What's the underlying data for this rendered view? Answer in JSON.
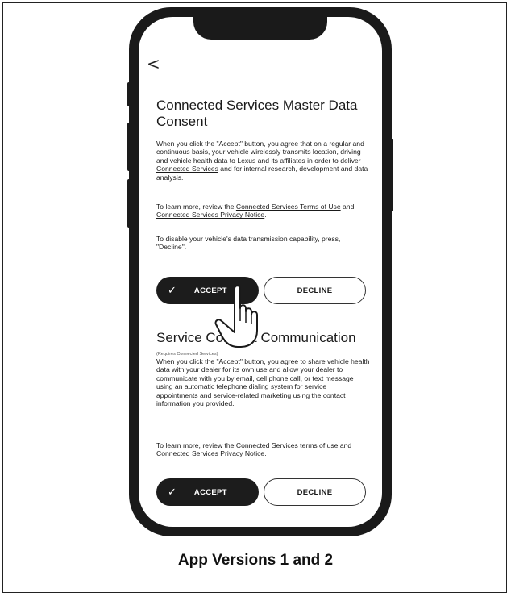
{
  "screen1": {
    "back_symbol": "<",
    "title": "Connected Services Master Data Consent",
    "para1_text": "When you click the \"Accept\" button, you agree that on a regular and continuous basis, your vehicle wirelessly transmits location, driving and vehicle health data to Lexus and its affiliates in order to deliver ",
    "para1_link": "Connected Services",
    "para1_end": " and for internal research, development and data analysis.",
    "para2_text": "To learn more, review the ",
    "para2_link1": "Connected Services Terms of Use",
    "para2_mid": " and ",
    "para2_link2": "Connected Services Privacy Notice",
    "para2_end": ".",
    "para3": "To disable your vehicle's data transmission capability, press, \"Decline\".",
    "accept_label": "ACCEPT",
    "decline_label": "DECLINE"
  },
  "screen2": {
    "title": "Service Connect Communication",
    "requires": "(Requires Connected Services)",
    "para1": "When you click the \"Accept\" button, you agree to share vehicle health data with your dealer for its own use and allow your dealer to communicate with you by email, cell phone call, or text message using an automatic telephone dialing system for service appointments and service-related marketing using the contact information you provided.",
    "para2_text": "To learn more, review the ",
    "para2_link1": "Connected Services terms of use",
    "para2_mid": " and ",
    "para2_link2": "Connected Services Privacy Notice",
    "para2_end": ".",
    "accept_label": "ACCEPT",
    "decline_label": "DECLINE"
  },
  "icons": {
    "check": "✓",
    "pointer": "hand-pointer-icon"
  },
  "caption": "App Versions 1 and 2",
  "colors": {
    "accent": "#1c1c1c",
    "text": "#1a1a1a",
    "background": "#ffffff"
  }
}
